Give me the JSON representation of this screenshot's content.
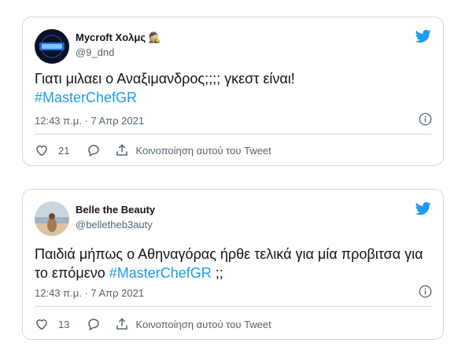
{
  "colors": {
    "accent": "#1d9bf0",
    "text": "#0f1419",
    "secondary": "#536471",
    "border": "#cfd9de"
  },
  "tweets": [
    {
      "display_name": "Mycroft Χολμς 🕵",
      "handle": "@9_dnd",
      "text_before": "Γιατι μιλαει ο Αναξιμανδρος;;;; γκεστ είναι!",
      "hashtag": "#MasterChefGR",
      "text_after": "",
      "timestamp": "12:43 π.μ. · 7 Απρ 2021",
      "likes": "21",
      "share_label": "Κοινοποίηση αυτού του Tweet",
      "avatar_icon": "dark-glow-avatar"
    },
    {
      "display_name": "Belle the Beauty",
      "handle": "@belletheb3auty",
      "text_before": "Παιδιά μήπως ο Αθηναγόρας ήρθε τελικά για μία προβιτσα για το επόμενο",
      "hashtag": "#MasterChefGR",
      "text_after": " ;;",
      "timestamp": "12:43 π.μ. · 7 Απρ 2021",
      "likes": "13",
      "share_label": "Κοινοποίηση αυτού του Tweet",
      "avatar_icon": "beach-photo-avatar"
    }
  ]
}
